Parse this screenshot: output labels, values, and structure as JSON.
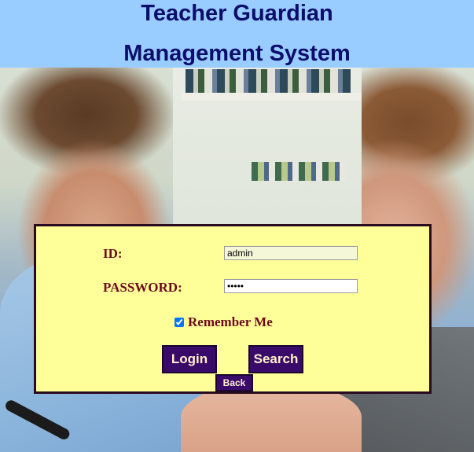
{
  "header": {
    "title_line1": "Teacher Guardian",
    "title_line2": "Management System",
    "background_color": "#99ccff",
    "text_color": "#0d0d6b"
  },
  "background_image": {
    "icon": "students-photo"
  },
  "login_form": {
    "background_color": "#ffff99",
    "id_label": "ID:",
    "id_value": "admin",
    "password_label": "PASSWORD:",
    "password_value": "•••••",
    "remember_me_label": "Remember Me",
    "remember_me_checked": true,
    "login_button": "Login",
    "search_button": "Search",
    "back_button": "Back",
    "button_color": "#3a0a6b",
    "label_color": "#6b0a1e"
  }
}
